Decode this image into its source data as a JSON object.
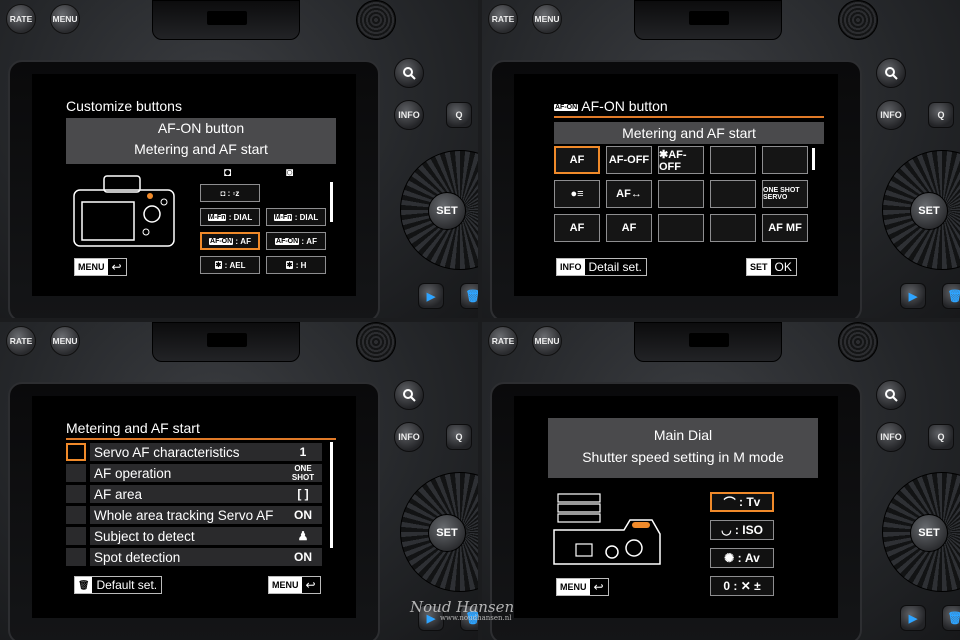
{
  "hardware": {
    "rate": "RATE",
    "menu": "MENU",
    "info": "INFO",
    "q": "Q",
    "set": "SET",
    "zoom_icon": "magnifier-icon",
    "play_icon": "play-icon",
    "trash_icon": "trash-icon"
  },
  "panel1": {
    "title": "Customize buttons",
    "subtitle1": "AF-ON button",
    "subtitle2": "Metering and AF start",
    "photo_icon": "camera-icon",
    "movie_icon": "movie-camera-icon",
    "left_col": [
      "M-Fn",
      "AF-ON",
      "✱"
    ],
    "left_vals": [
      "DIAL FUNC",
      "AF",
      "AEL FEL"
    ],
    "right_col": [
      "M-Fn",
      "AF-ON",
      "✱"
    ],
    "right_vals": [
      "DIAL FUNC",
      "AF",
      "H"
    ],
    "menu_label": "MENU"
  },
  "panel2": {
    "title_tag": "AF-ON",
    "title": "AF-ON button",
    "subtitle": "Metering and AF start",
    "cells": [
      "AF",
      "AF-OFF",
      "✱AF-OFF",
      "",
      "",
      "●≡",
      "AF↔",
      "",
      "",
      "ONE SHOT SERVO",
      "AF",
      "AF",
      "",
      "",
      "AF MF"
    ],
    "info_label": "INFO",
    "info_text": "Detail set.",
    "set_label": "SET",
    "set_text": "OK"
  },
  "panel3": {
    "title": "Metering and AF start",
    "rows": [
      {
        "name": "Servo AF characteristics",
        "value": "1"
      },
      {
        "name": "AF operation",
        "value": "ONE SHOT"
      },
      {
        "name": "AF area",
        "value": "[ ]"
      },
      {
        "name": "Whole area tracking Servo AF",
        "value": "ON"
      },
      {
        "name": "Subject to detect",
        "value": "♟"
      },
      {
        "name": "Spot detection",
        "value": "ON"
      }
    ],
    "default_text": "Default set.",
    "menu_label": "MENU"
  },
  "panel4": {
    "title1": "Main Dial",
    "title2": "Shutter speed setting in M mode",
    "options": [
      {
        "icon": "⌒",
        "value": "Tv"
      },
      {
        "icon": "◡",
        "value": "ISO"
      },
      {
        "icon": "✺",
        "value": "Av"
      },
      {
        "icon": "0",
        "value": "✕ ±"
      }
    ],
    "menu_label": "MENU"
  },
  "colors": {
    "accent": "#f08a2a",
    "screen_bg": "#000000",
    "highlight_bar": "#4a4a4c",
    "info_blue": "#2ea4ff"
  }
}
